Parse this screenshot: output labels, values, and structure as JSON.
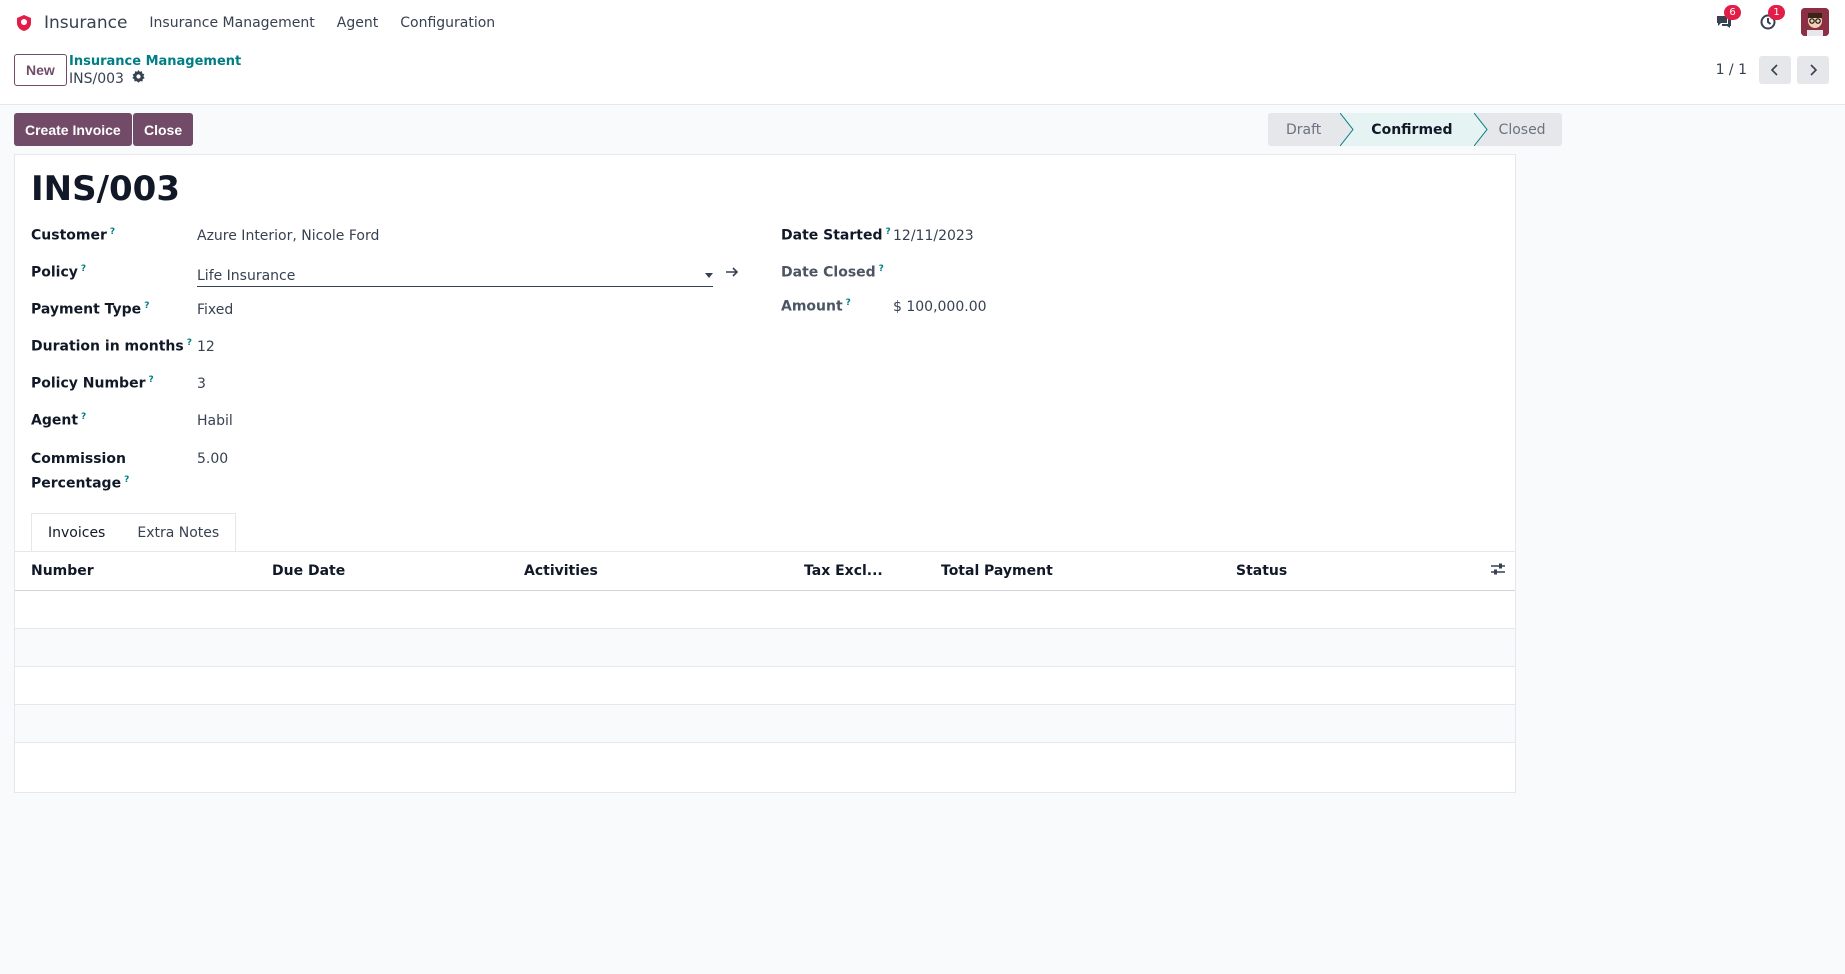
{
  "app": {
    "name": "Insurance",
    "menu": [
      "Insurance Management",
      "Agent",
      "Configuration"
    ],
    "messages_count": "6",
    "activities_count": "1"
  },
  "control": {
    "new_label": "New",
    "breadcrumb_parent": "Insurance Management",
    "breadcrumb_current": "INS/003",
    "pager": "1 / 1"
  },
  "actions": {
    "create_invoice": "Create Invoice",
    "close": "Close"
  },
  "status": {
    "steps": [
      "Draft",
      "Confirmed",
      "Closed"
    ],
    "current": "Confirmed"
  },
  "record": {
    "title": "INS/003",
    "left_fields": [
      {
        "label": "Customer",
        "value": "Azure Interior, Nicole Ford"
      },
      {
        "label": "Policy",
        "value": "Life Insurance"
      },
      {
        "label": "Payment Type",
        "value": "Fixed"
      },
      {
        "label": "Duration in months",
        "value": "12"
      },
      {
        "label": "Policy Number",
        "value": "3"
      },
      {
        "label": "Agent",
        "value": "Habil"
      },
      {
        "label": "Commission",
        "label2": "Percentage",
        "value": "5.00"
      }
    ],
    "right_fields": [
      {
        "label": "Date Started",
        "value": "12/11/2023"
      },
      {
        "label": "Date Closed",
        "value": ""
      },
      {
        "label": "Amount",
        "value": "$ 100,000.00"
      }
    ],
    "help_mark": "?"
  },
  "tabs": [
    "Invoices",
    "Extra Notes"
  ],
  "table": {
    "columns": [
      "Number",
      "Due Date",
      "Activities",
      "Tax Excl...",
      "Total",
      "Payment",
      "Status"
    ],
    "rows": []
  },
  "colors": {
    "brand": "#714b67",
    "link": "#017e84",
    "badge": "#e11d48"
  }
}
